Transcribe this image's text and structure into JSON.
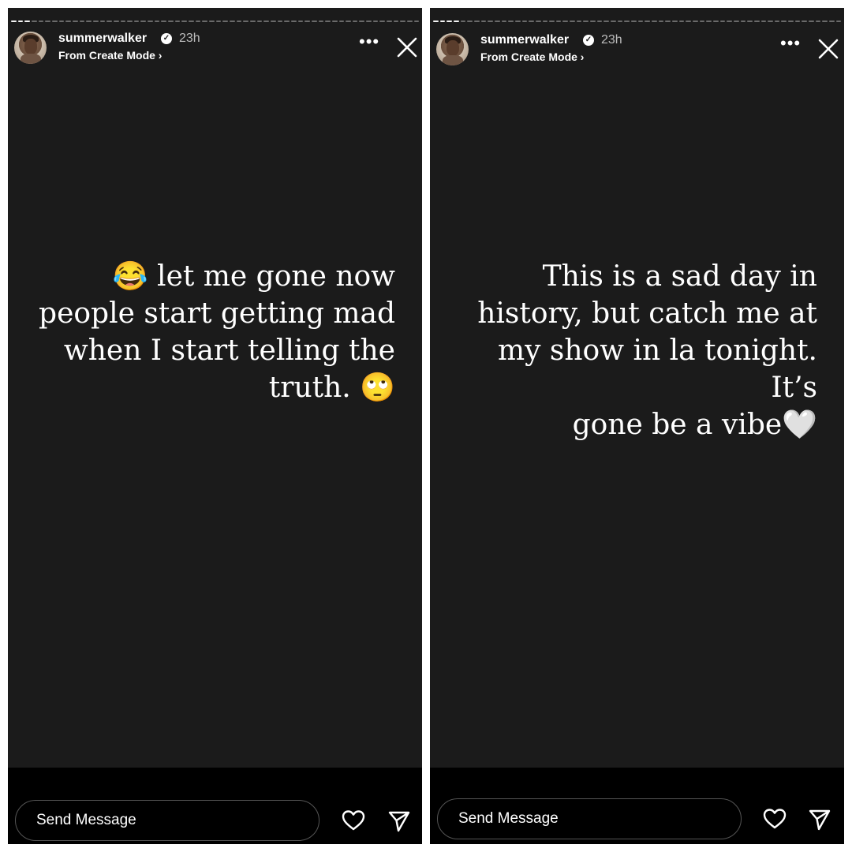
{
  "panels": [
    {
      "user": {
        "username": "summerwalker",
        "time": "23h",
        "subtitle": "From Create Mode ›"
      },
      "story": {
        "lines": [
          "😂 let me gone now",
          "people start getting mad",
          "when I start telling the",
          "truth. 🙄"
        ]
      },
      "reply": {
        "placeholder": "Send Message"
      },
      "icons": [
        "more-icon",
        "close-icon",
        "heart-icon",
        "send-icon",
        "verified-badge-icon"
      ]
    },
    {
      "user": {
        "username": "summerwalker",
        "time": "23h",
        "subtitle": "From Create Mode ›"
      },
      "story": {
        "lines": [
          "This is a sad day in",
          "history, but catch me at",
          "my show in la tonight. It’s",
          "gone be a vibe🤍"
        ]
      },
      "reply": {
        "placeholder": "Send Message"
      },
      "icons": [
        "more-icon",
        "close-icon",
        "heart-icon",
        "send-icon",
        "verified-badge-icon"
      ]
    }
  ],
  "colors": {
    "story_bg": "#1b1b1b",
    "bar_bg": "#000000",
    "text": "#ffffff",
    "muted": "#bdbdbd"
  }
}
